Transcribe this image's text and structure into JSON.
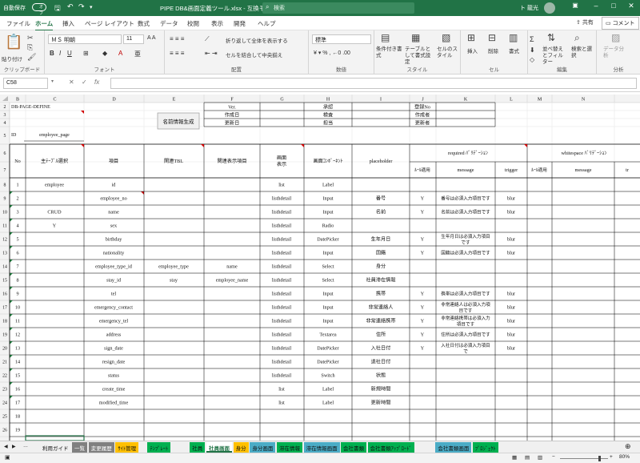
{
  "titlebar": {
    "autosave_label": "自動保存",
    "autosave_state": "オフ",
    "title": "PIPE DB&画面定義ツール.xlsx - 互換モード",
    "search_placeholder": "検索",
    "user": "ト 龍光"
  },
  "tabs": [
    "ファイル",
    "ホーム",
    "挿入",
    "ページ レイアウト",
    "数式",
    "データ",
    "校閲",
    "表示",
    "開発",
    "ヘルプ"
  ],
  "active_tab": "ホーム",
  "share_label": "共有",
  "comment_label": "コメント",
  "ribbon": {
    "clipboard": {
      "paste": "貼り付け",
      "label": "クリップボード"
    },
    "font": {
      "name": "ＭＳ 明朝",
      "size": "11",
      "label": "フォント"
    },
    "alignment": {
      "wrap": "折り返して全体を表示する",
      "merge": "セルを結合して中央揃え",
      "label": "配置"
    },
    "number": {
      "format": "標準",
      "label": "数値"
    },
    "styles": {
      "conditional": "条件付き書式",
      "table": "テーブルとして書式設定",
      "cell": "セルのスタイル",
      "label": "スタイル"
    },
    "cells": {
      "insert": "挿入",
      "delete": "削除",
      "format": "書式",
      "label": "セル"
    },
    "editing": {
      "sort": "並べ替えとフィルター",
      "find": "検索と選択",
      "label": "編集"
    },
    "analysis": {
      "analyze": "データ分析",
      "label": "分析"
    }
  },
  "formula_bar": {
    "namebox": "C58",
    "value": ""
  },
  "columns": [
    "B",
    "C",
    "D",
    "E",
    "F",
    "G",
    "H",
    "I",
    "J",
    "K",
    "L",
    "M",
    "N"
  ],
  "header_block": {
    "define": "DB-PAGE-DEFINE",
    "id_label": "ID",
    "id_value": "employee_page",
    "button": "名前情報生成",
    "ver": "Ver.",
    "created": "作成日",
    "updated": "更新日",
    "approve": "承認",
    "check": "検査",
    "owner": "担当",
    "reg_no": "登録No",
    "creator": "作成者",
    "updater": "更新者"
  },
  "table_headers": {
    "no": "No",
    "main_table": "主ﾃｰﾌﾞﾙ選択",
    "item": "項目",
    "related_tbl": "関連TBL",
    "related_display": "関連表示項目",
    "screen_display": "画面\n表示",
    "component": "画面ｺﾝﾎﾟｰﾈﾝﾄ",
    "placeholder": "placeholder",
    "required_validation": "required ﾊﾞﾘﾃﾞｰｼｮﾝ",
    "whitespace_validation": "whitespace ﾊﾞﾘﾃﾞｰｼｮﾝ",
    "rule_apply": "ﾙｰﾙ適用",
    "message": "message",
    "trigger": "trigger"
  },
  "rows": [
    {
      "no": "1",
      "main": "employee",
      "item": "id",
      "rtbl": "",
      "rdisp": "",
      "disp": "list",
      "comp": "Label",
      "ph": "",
      "req": "",
      "msg": "",
      "trig": ""
    },
    {
      "no": "2",
      "main": "",
      "item": "employee_no",
      "rtbl": "",
      "rdisp": "",
      "disp": "listhdetail",
      "comp": "Input",
      "ph": "番号",
      "req": "Y",
      "msg": "番号は必須入力項目です",
      "trig": "blur"
    },
    {
      "no": "3",
      "main": "CRUD",
      "item": "name",
      "rtbl": "",
      "rdisp": "",
      "disp": "listhdetail",
      "comp": "Input",
      "ph": "名前",
      "req": "Y",
      "msg": "名前は必須入力項目です",
      "trig": "blur"
    },
    {
      "no": "4",
      "main": "Y",
      "item": "sex",
      "rtbl": "",
      "rdisp": "",
      "disp": "listhdetail",
      "comp": "Radio",
      "ph": "",
      "req": "",
      "msg": "",
      "trig": ""
    },
    {
      "no": "5",
      "main": "",
      "item": "birthday",
      "rtbl": "",
      "rdisp": "",
      "disp": "listhdetail",
      "comp": "DatePicker",
      "ph": "生年月日",
      "req": "Y",
      "msg": "生年月日は必須入力項目です",
      "trig": "blur"
    },
    {
      "no": "6",
      "main": "",
      "item": "nationality",
      "rtbl": "",
      "rdisp": "",
      "disp": "listhdetail",
      "comp": "Input",
      "ph": "国籍",
      "req": "Y",
      "msg": "国籍は必須入力項目です",
      "trig": "blur"
    },
    {
      "no": "7",
      "main": "",
      "item": "employee_type_id",
      "rtbl": "employee_type",
      "rdisp": "name",
      "disp": "listhdetail",
      "comp": "Select",
      "ph": "身分",
      "req": "",
      "msg": "",
      "trig": ""
    },
    {
      "no": "8",
      "main": "",
      "item": "stay_id",
      "rtbl": "stay",
      "rdisp": "employee_name",
      "disp": "listhdetail",
      "comp": "Select",
      "ph": "社員滞在情報",
      "req": "",
      "msg": "",
      "trig": ""
    },
    {
      "no": "9",
      "main": "",
      "item": "tel",
      "rtbl": "",
      "rdisp": "",
      "disp": "listhdetail",
      "comp": "Input",
      "ph": "携帯",
      "req": "Y",
      "msg": "携帯は必須入力項目です",
      "trig": "blur"
    },
    {
      "no": "10",
      "main": "",
      "item": "emergency_contact",
      "rtbl": "",
      "rdisp": "",
      "disp": "listhdetail",
      "comp": "Input",
      "ph": "非常連絡人",
      "req": "Y",
      "msg": "非常連絡人は必須入力項目です",
      "trig": "blur"
    },
    {
      "no": "11",
      "main": "",
      "item": "emergency_tel",
      "rtbl": "",
      "rdisp": "",
      "disp": "listhdetail",
      "comp": "Input",
      "ph": "非常連絡携帯",
      "req": "Y",
      "msg": "非常連絡携帯は必須入力項目です",
      "trig": "blur"
    },
    {
      "no": "12",
      "main": "",
      "item": "address",
      "rtbl": "",
      "rdisp": "",
      "disp": "listhdetail",
      "comp": "Textarea",
      "ph": "住所",
      "req": "Y",
      "msg": "住所は必須入力項目です",
      "trig": "blur"
    },
    {
      "no": "13",
      "main": "",
      "item": "sign_date",
      "rtbl": "",
      "rdisp": "",
      "disp": "listhdetail",
      "comp": "DatePicker",
      "ph": "入社日付",
      "req": "Y",
      "msg": "入社日付は必須入力項目で",
      "trig": "blur"
    },
    {
      "no": "14",
      "main": "",
      "item": "resign_date",
      "rtbl": "",
      "rdisp": "",
      "disp": "listhdetail",
      "comp": "DatePicker",
      "ph": "退社日付",
      "req": "",
      "msg": "",
      "trig": ""
    },
    {
      "no": "15",
      "main": "",
      "item": "status",
      "rtbl": "",
      "rdisp": "",
      "disp": "listhdetail",
      "comp": "Switch",
      "ph": "状態",
      "req": "",
      "msg": "",
      "trig": ""
    },
    {
      "no": "16",
      "main": "",
      "item": "create_time",
      "rtbl": "",
      "rdisp": "",
      "disp": "list",
      "comp": "Label",
      "ph": "新規時間",
      "req": "",
      "msg": "",
      "trig": ""
    },
    {
      "no": "17",
      "main": "",
      "item": "modified_time",
      "rtbl": "",
      "rdisp": "",
      "disp": "list",
      "comp": "Label",
      "ph": "更新時間",
      "req": "",
      "msg": "",
      "trig": ""
    },
    {
      "no": "18",
      "main": "",
      "item": "",
      "rtbl": "",
      "rdisp": "",
      "disp": "",
      "comp": "",
      "ph": "",
      "req": "",
      "msg": "",
      "trig": ""
    },
    {
      "no": "19",
      "main": "",
      "item": "",
      "rtbl": "",
      "rdisp": "",
      "disp": "",
      "comp": "",
      "ph": "",
      "req": "",
      "msg": "",
      "trig": ""
    },
    {
      "no": "20",
      "main": "",
      "item": "",
      "rtbl": "",
      "rdisp": "",
      "disp": "",
      "comp": "",
      "ph": "",
      "req": "",
      "msg": "",
      "trig": ""
    }
  ],
  "row_numbers": [
    "2",
    "3",
    "4",
    "5",
    "6",
    "7",
    "8",
    "9",
    "10",
    "11",
    "12",
    "13",
    "14",
    "15",
    "16",
    "17",
    "18",
    "19",
    "20",
    "21",
    "22",
    "23",
    "24",
    "25",
    "26",
    "27",
    "28",
    "29"
  ],
  "sheet_tabs": [
    {
      "label": "利用ガイド",
      "color": "#f0f0f0"
    },
    {
      "label": "一覧",
      "color": "#808080"
    },
    {
      "label": "変更履歴",
      "color": "#808080"
    },
    {
      "label": "ｻｲﾄ管理",
      "color": "#ffc000"
    },
    {
      "label": "ﾃﾝﾌﾟﾚｰﾄ",
      "color": "#00b050"
    },
    {
      "label": "社員",
      "color": "#00b050"
    },
    {
      "label": "社員画面",
      "color": "#ffffff"
    },
    {
      "label": "身分",
      "color": "#ffc000"
    },
    {
      "label": "身分画面",
      "color": "#4bacc6"
    },
    {
      "label": "滞在情報",
      "color": "#00b050"
    },
    {
      "label": "滞在情報画面",
      "color": "#4bacc6"
    },
    {
      "label": "会社書類",
      "color": "#00b050"
    },
    {
      "label": "会社書類ｱｯﾌﾟﾛｰﾄﾞ",
      "color": "#00b050"
    },
    {
      "label": "会社書類画面",
      "color": "#4bacc6"
    },
    {
      "label": "ﾌﾟﾛｼﾞｪｸﾄ",
      "color": "#00b050"
    }
  ],
  "zoom": "80%"
}
